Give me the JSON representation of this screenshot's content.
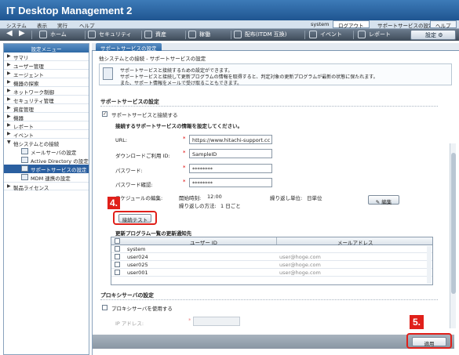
{
  "app": {
    "title": "IT Desktop Management 2"
  },
  "menubar": {
    "items": [
      "システム",
      "表示",
      "実行",
      "ヘルプ"
    ],
    "user": "system",
    "logout": "ログアウト",
    "support_settings": "サポートサービスの設定",
    "help": "ヘルプ"
  },
  "navbar": {
    "items": [
      "ホーム",
      "セキュリティ",
      "資産",
      "稼働",
      "配布(ITDM 互換)",
      "イベント",
      "レポート"
    ],
    "settings": "設定"
  },
  "sidebar": {
    "header": "設定メニュー",
    "items": [
      "サマリ",
      "ユーザー管理",
      "エージェント",
      "機器の探索",
      "ネットワーク制御",
      "セキュリティ管理",
      "資産管理",
      "機器",
      "レポート",
      "イベント",
      "他システムとの接続"
    ],
    "subitems": [
      "メールサーバの設定",
      "Active Directory の設定",
      "サポートサービスの設定",
      "MDM 連携の設定"
    ],
    "last_item": "製品ライセンス"
  },
  "tab": {
    "label": "サポートサービスの設定"
  },
  "breadcrumb": "他システムとの接続 - サポートサービスの設定",
  "description": [
    "サポートサービスと接続するための設定ができます。",
    "サポートサービスと接続して更新プログラムの情報を取得すると、判定対象の更新プログラムが最新の状態に保たれます。",
    "また、サポート情報をメールで受け取ることもできます。"
  ],
  "support": {
    "section_title": "サポートサービスの設定",
    "connect_checkbox": "サポートサービスと接続する",
    "info_title": "接続するサポートサービスの情報を設定してください。",
    "url_label": "URL:",
    "url_value": "https://www.hitachi-support.cc",
    "id_label": "ダウンロードご利用 ID:",
    "id_value": "SampleID",
    "password_label": "パスワード:",
    "password_value": "********",
    "password_confirm_label": "パスワード確認:",
    "password_confirm_value": "********",
    "schedule_label": "スケジュールの編集:",
    "start_time_label": "開始時刻:",
    "start_time": "12:00",
    "repeat_unit_label": "繰り返し単位:",
    "repeat_unit": "日単位",
    "repeat_method_label": "繰り返しの方法:",
    "repeat_method": "1 日ごと",
    "edit_button": "編集",
    "test_button": "接続テスト"
  },
  "notify": {
    "title": "更新プログラム一覧の更新通知先",
    "col_user": "ユーザー ID",
    "col_mail": "メールアドレス",
    "rows": [
      {
        "user": "system",
        "mail": ""
      },
      {
        "user": "user024",
        "mail": "user@hoge.com"
      },
      {
        "user": "user025",
        "mail": "user@hoge.com"
      },
      {
        "user": "user001",
        "mail": "user@hoge.com"
      }
    ]
  },
  "proxy": {
    "section_title": "プロキシサーバの設定",
    "use_checkbox": "プロキシサーバを使用する",
    "ip_label": "IP アドレス:"
  },
  "apply_button": "適用",
  "callouts": {
    "step4": "4.",
    "step5": "5."
  },
  "colors": {
    "callout_red": "#e0201a",
    "title_blue": "#1f5591",
    "selected_blue": "#2a5fa0"
  }
}
